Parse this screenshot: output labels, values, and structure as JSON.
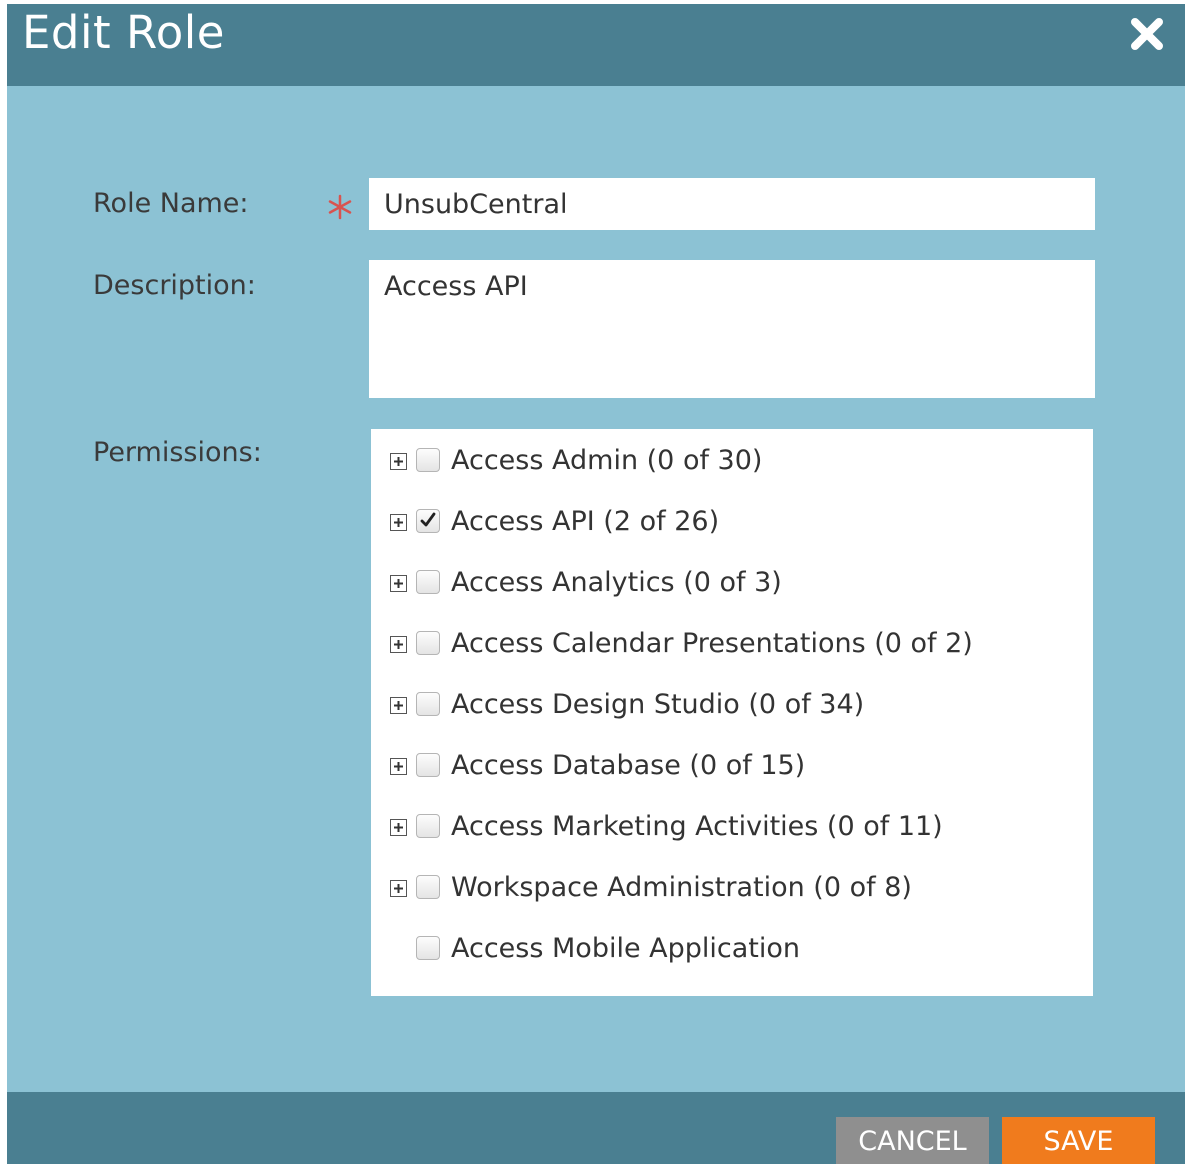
{
  "dialog": {
    "title": "Edit Role",
    "close_icon": "close-icon"
  },
  "form": {
    "role_name_label": "Role Name:",
    "role_name_value": "UnsubCentral",
    "required_icon": "required-asterisk-icon",
    "description_label": "Description:",
    "description_value": "Access API",
    "permissions_label": "Permissions:"
  },
  "permissions": [
    {
      "label": "Access Admin (0 of 30)",
      "checked": false,
      "expandable": true
    },
    {
      "label": "Access API (2 of 26)",
      "checked": true,
      "expandable": true
    },
    {
      "label": "Access Analytics (0 of 3)",
      "checked": false,
      "expandable": true
    },
    {
      "label": "Access Calendar Presentations (0 of 2)",
      "checked": false,
      "expandable": true
    },
    {
      "label": "Access Design Studio (0 of 34)",
      "checked": false,
      "expandable": true
    },
    {
      "label": "Access Database (0 of 15)",
      "checked": false,
      "expandable": true
    },
    {
      "label": "Access Marketing Activities (0 of 11)",
      "checked": false,
      "expandable": true
    },
    {
      "label": "Workspace Administration (0 of 8)",
      "checked": false,
      "expandable": true
    },
    {
      "label": "Access Mobile Application",
      "checked": false,
      "expandable": false
    }
  ],
  "footer": {
    "cancel_label": "CANCEL",
    "save_label": "SAVE"
  },
  "colors": {
    "header": "#4a7f91",
    "body": "#8cc2d4",
    "save": "#f07b1d",
    "cancel": "#8f8f8f",
    "required": "#d9534f"
  }
}
